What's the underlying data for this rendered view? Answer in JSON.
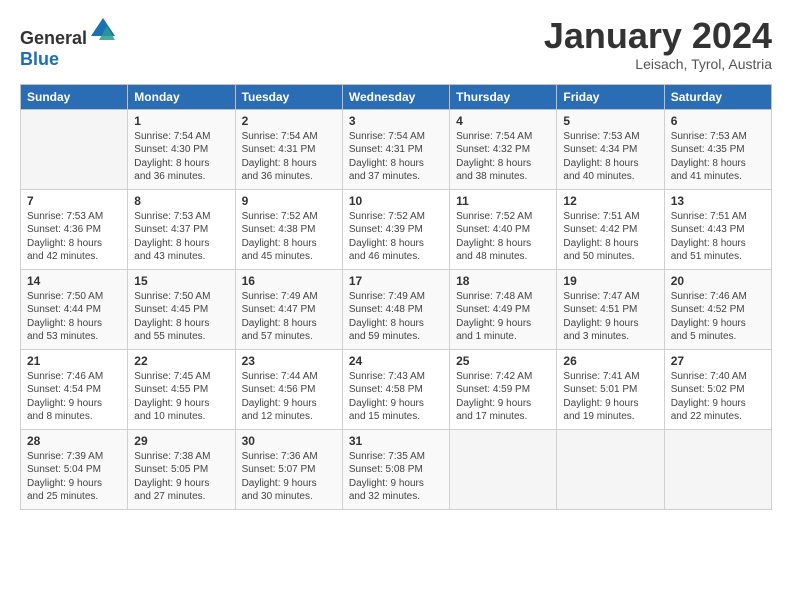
{
  "header": {
    "logo_general": "General",
    "logo_blue": "Blue",
    "month_title": "January 2024",
    "location": "Leisach, Tyrol, Austria"
  },
  "weekdays": [
    "Sunday",
    "Monday",
    "Tuesday",
    "Wednesday",
    "Thursday",
    "Friday",
    "Saturday"
  ],
  "weeks": [
    [
      {
        "day": "",
        "sunrise": "",
        "sunset": "",
        "daylight": ""
      },
      {
        "day": "1",
        "sunrise": "Sunrise: 7:54 AM",
        "sunset": "Sunset: 4:30 PM",
        "daylight": "Daylight: 8 hours and 36 minutes."
      },
      {
        "day": "2",
        "sunrise": "Sunrise: 7:54 AM",
        "sunset": "Sunset: 4:31 PM",
        "daylight": "Daylight: 8 hours and 36 minutes."
      },
      {
        "day": "3",
        "sunrise": "Sunrise: 7:54 AM",
        "sunset": "Sunset: 4:31 PM",
        "daylight": "Daylight: 8 hours and 37 minutes."
      },
      {
        "day": "4",
        "sunrise": "Sunrise: 7:54 AM",
        "sunset": "Sunset: 4:32 PM",
        "daylight": "Daylight: 8 hours and 38 minutes."
      },
      {
        "day": "5",
        "sunrise": "Sunrise: 7:53 AM",
        "sunset": "Sunset: 4:34 PM",
        "daylight": "Daylight: 8 hours and 40 minutes."
      },
      {
        "day": "6",
        "sunrise": "Sunrise: 7:53 AM",
        "sunset": "Sunset: 4:35 PM",
        "daylight": "Daylight: 8 hours and 41 minutes."
      }
    ],
    [
      {
        "day": "7",
        "sunrise": "Sunrise: 7:53 AM",
        "sunset": "Sunset: 4:36 PM",
        "daylight": "Daylight: 8 hours and 42 minutes."
      },
      {
        "day": "8",
        "sunrise": "Sunrise: 7:53 AM",
        "sunset": "Sunset: 4:37 PM",
        "daylight": "Daylight: 8 hours and 43 minutes."
      },
      {
        "day": "9",
        "sunrise": "Sunrise: 7:52 AM",
        "sunset": "Sunset: 4:38 PM",
        "daylight": "Daylight: 8 hours and 45 minutes."
      },
      {
        "day": "10",
        "sunrise": "Sunrise: 7:52 AM",
        "sunset": "Sunset: 4:39 PM",
        "daylight": "Daylight: 8 hours and 46 minutes."
      },
      {
        "day": "11",
        "sunrise": "Sunrise: 7:52 AM",
        "sunset": "Sunset: 4:40 PM",
        "daylight": "Daylight: 8 hours and 48 minutes."
      },
      {
        "day": "12",
        "sunrise": "Sunrise: 7:51 AM",
        "sunset": "Sunset: 4:42 PM",
        "daylight": "Daylight: 8 hours and 50 minutes."
      },
      {
        "day": "13",
        "sunrise": "Sunrise: 7:51 AM",
        "sunset": "Sunset: 4:43 PM",
        "daylight": "Daylight: 8 hours and 51 minutes."
      }
    ],
    [
      {
        "day": "14",
        "sunrise": "Sunrise: 7:50 AM",
        "sunset": "Sunset: 4:44 PM",
        "daylight": "Daylight: 8 hours and 53 minutes."
      },
      {
        "day": "15",
        "sunrise": "Sunrise: 7:50 AM",
        "sunset": "Sunset: 4:45 PM",
        "daylight": "Daylight: 8 hours and 55 minutes."
      },
      {
        "day": "16",
        "sunrise": "Sunrise: 7:49 AM",
        "sunset": "Sunset: 4:47 PM",
        "daylight": "Daylight: 8 hours and 57 minutes."
      },
      {
        "day": "17",
        "sunrise": "Sunrise: 7:49 AM",
        "sunset": "Sunset: 4:48 PM",
        "daylight": "Daylight: 8 hours and 59 minutes."
      },
      {
        "day": "18",
        "sunrise": "Sunrise: 7:48 AM",
        "sunset": "Sunset: 4:49 PM",
        "daylight": "Daylight: 9 hours and 1 minute."
      },
      {
        "day": "19",
        "sunrise": "Sunrise: 7:47 AM",
        "sunset": "Sunset: 4:51 PM",
        "daylight": "Daylight: 9 hours and 3 minutes."
      },
      {
        "day": "20",
        "sunrise": "Sunrise: 7:46 AM",
        "sunset": "Sunset: 4:52 PM",
        "daylight": "Daylight: 9 hours and 5 minutes."
      }
    ],
    [
      {
        "day": "21",
        "sunrise": "Sunrise: 7:46 AM",
        "sunset": "Sunset: 4:54 PM",
        "daylight": "Daylight: 9 hours and 8 minutes."
      },
      {
        "day": "22",
        "sunrise": "Sunrise: 7:45 AM",
        "sunset": "Sunset: 4:55 PM",
        "daylight": "Daylight: 9 hours and 10 minutes."
      },
      {
        "day": "23",
        "sunrise": "Sunrise: 7:44 AM",
        "sunset": "Sunset: 4:56 PM",
        "daylight": "Daylight: 9 hours and 12 minutes."
      },
      {
        "day": "24",
        "sunrise": "Sunrise: 7:43 AM",
        "sunset": "Sunset: 4:58 PM",
        "daylight": "Daylight: 9 hours and 15 minutes."
      },
      {
        "day": "25",
        "sunrise": "Sunrise: 7:42 AM",
        "sunset": "Sunset: 4:59 PM",
        "daylight": "Daylight: 9 hours and 17 minutes."
      },
      {
        "day": "26",
        "sunrise": "Sunrise: 7:41 AM",
        "sunset": "Sunset: 5:01 PM",
        "daylight": "Daylight: 9 hours and 19 minutes."
      },
      {
        "day": "27",
        "sunrise": "Sunrise: 7:40 AM",
        "sunset": "Sunset: 5:02 PM",
        "daylight": "Daylight: 9 hours and 22 minutes."
      }
    ],
    [
      {
        "day": "28",
        "sunrise": "Sunrise: 7:39 AM",
        "sunset": "Sunset: 5:04 PM",
        "daylight": "Daylight: 9 hours and 25 minutes."
      },
      {
        "day": "29",
        "sunrise": "Sunrise: 7:38 AM",
        "sunset": "Sunset: 5:05 PM",
        "daylight": "Daylight: 9 hours and 27 minutes."
      },
      {
        "day": "30",
        "sunrise": "Sunrise: 7:36 AM",
        "sunset": "Sunset: 5:07 PM",
        "daylight": "Daylight: 9 hours and 30 minutes."
      },
      {
        "day": "31",
        "sunrise": "Sunrise: 7:35 AM",
        "sunset": "Sunset: 5:08 PM",
        "daylight": "Daylight: 9 hours and 32 minutes."
      },
      {
        "day": "",
        "sunrise": "",
        "sunset": "",
        "daylight": ""
      },
      {
        "day": "",
        "sunrise": "",
        "sunset": "",
        "daylight": ""
      },
      {
        "day": "",
        "sunrise": "",
        "sunset": "",
        "daylight": ""
      }
    ]
  ]
}
